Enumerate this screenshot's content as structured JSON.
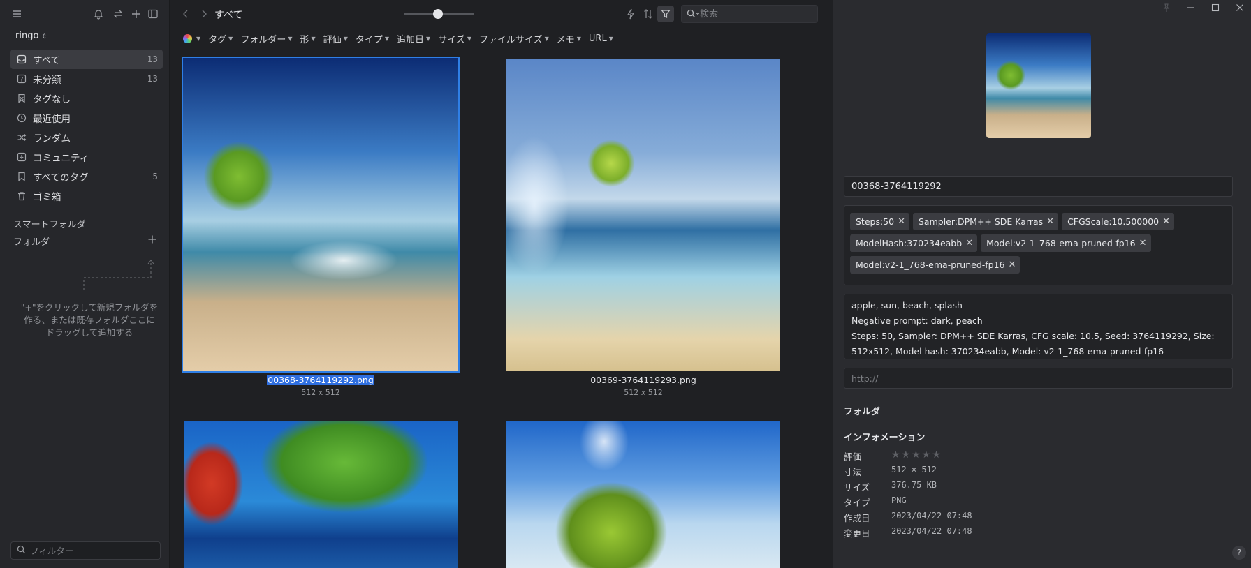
{
  "sidebar": {
    "library_name": "ringo",
    "items": [
      {
        "label": "すべて",
        "count": "13",
        "icon": "inbox-icon"
      },
      {
        "label": "未分類",
        "count": "13",
        "icon": "question-box-icon"
      },
      {
        "label": "タグなし",
        "count": "",
        "icon": "tag-off-icon"
      },
      {
        "label": "最近使用",
        "count": "",
        "icon": "clock-icon"
      },
      {
        "label": "ランダム",
        "count": "",
        "icon": "shuffle-icon"
      },
      {
        "label": "コミュニティ",
        "count": "",
        "icon": "download-box-icon"
      },
      {
        "label": "すべてのタグ",
        "count": "5",
        "icon": "bookmark-icon"
      },
      {
        "label": "ゴミ箱",
        "count": "",
        "icon": "trash-icon"
      }
    ],
    "smart_folder_label": "スマートフォルダ",
    "folder_label": "フォルダ",
    "hint_line1": "\"+\"をクリックして新規フォルダを",
    "hint_line2": "作る、または既存フォルダここに",
    "hint_line3": "ドラッグして追加する",
    "filter_placeholder": "フィルター"
  },
  "toolbar": {
    "breadcrumb": "すべて",
    "search_placeholder": "検索",
    "zoom_level": 0.4
  },
  "filters": [
    "タグ",
    "フォルダー",
    "形",
    "評価",
    "タイプ",
    "追加日",
    "サイズ",
    "ファイルサイズ",
    "メモ",
    "URL"
  ],
  "grid": {
    "items": [
      {
        "name": "00368-3764119292.png",
        "dims": "512 x 512",
        "selected": true
      },
      {
        "name": "00369-3764119293.png",
        "dims": "512 x 512",
        "selected": false
      }
    ]
  },
  "inspector": {
    "file_name": "00368-3764119292",
    "tags": [
      "Steps:50",
      "Sampler:DPM++ SDE Karras",
      "CFGScale:10.500000",
      "ModelHash:370234eabb",
      "Model:v2-1_768-ema-pruned-fp16",
      "Model:v2-1_768-ema-pruned-fp16"
    ],
    "notes_line1": "apple, sun, beach, splash",
    "notes_line2": "Negative prompt: dark, peach",
    "notes_line3": "Steps: 50, Sampler: DPM++ SDE Karras, CFG scale: 10.5, Seed: 3764119292, Size:",
    "notes_line4": "512x512, Model hash: 370234eabb, Model: v2-1_768-ema-pruned-fp16",
    "url_placeholder": "http://",
    "folder_heading": "フォルダ",
    "info_heading": "インフォメーション",
    "info": {
      "rating_label": "評価",
      "rating_value": 0,
      "dims_label": "寸法",
      "dims_value": "512 × 512",
      "size_label": "サイズ",
      "size_value": "376.75 KB",
      "type_label": "タイプ",
      "type_value": "PNG",
      "created_label": "作成日",
      "created_value": "2023/04/22 07:48",
      "modified_label": "変更日",
      "modified_value": "2023/04/22 07:48"
    },
    "help": "?"
  }
}
